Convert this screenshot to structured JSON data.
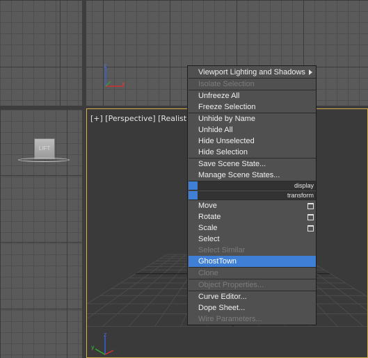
{
  "viewports": {
    "perspective_label": "[+] [Perspective] [Realistic",
    "axis_labels": {
      "x": "x",
      "y": "y",
      "z": "z"
    },
    "box_label": "LIFT"
  },
  "colors": {
    "active_viewport_border": "#d8b04a",
    "menu_highlight": "#3f7fd5",
    "menu_background": "#505050"
  },
  "menu": {
    "viewport_lighting": "Viewport Lighting and Shadows",
    "isolate_selection": "Isolate Selection",
    "unfreeze_all": "Unfreeze All",
    "freeze_selection": "Freeze Selection",
    "unhide_by_name": "Unhide by Name",
    "unhide_all": "Unhide All",
    "hide_unselected": "Hide Unselected",
    "hide_selection": "Hide Selection",
    "save_scene_state": "Save Scene State...",
    "manage_scene_states": "Manage Scene States...",
    "display_header": "display",
    "transform_header": "transform",
    "move": "Move",
    "rotate": "Rotate",
    "scale": "Scale",
    "select": "Select",
    "select_similar": "Select Similar",
    "ghosttown": "GhostTown",
    "clone": "Clone",
    "object_properties": "Object Properties...",
    "curve_editor": "Curve Editor...",
    "dope_sheet": "Dope Sheet...",
    "wire_parameters": "Wire Parameters..."
  }
}
